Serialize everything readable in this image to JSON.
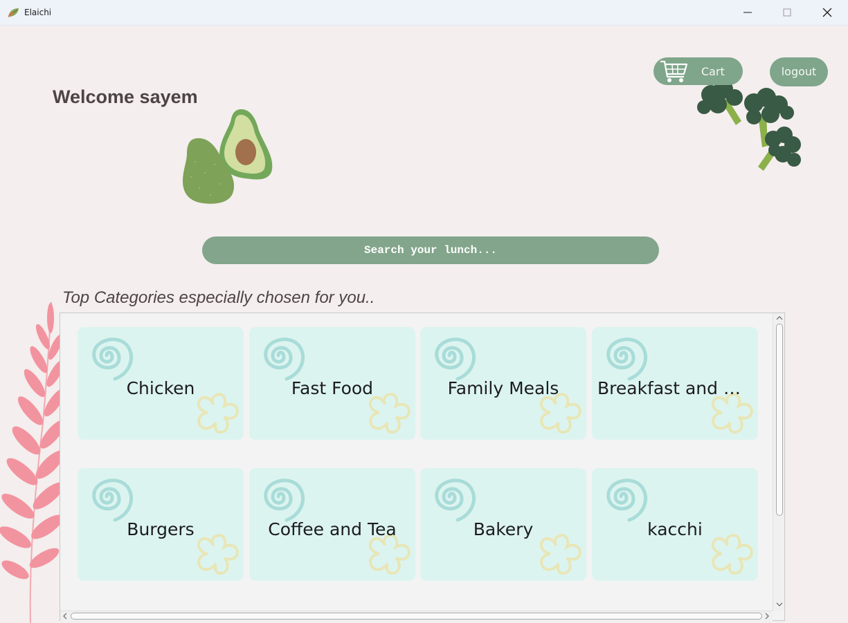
{
  "window": {
    "title": "Elaichi",
    "app_icon": "leaf-icon",
    "controls": [
      "minimize-icon",
      "maximize-icon",
      "close-icon"
    ]
  },
  "header": {
    "welcome": "Welcome sayem",
    "cart_label": "Cart",
    "cart_icon": "shopping-cart-icon",
    "logout_label": "logout"
  },
  "search": {
    "placeholder": "Search your lunch..."
  },
  "categories": {
    "title": "Top Categories especially chosen for you..",
    "items": [
      {
        "label": "Chicken"
      },
      {
        "label": "Fast Food"
      },
      {
        "label": "Family Meals"
      },
      {
        "label": "Breakfast and Br..."
      },
      {
        "label": "Burgers"
      },
      {
        "label": "Coffee and Tea"
      },
      {
        "label": "Bakery"
      },
      {
        "label": "kacchi"
      }
    ]
  },
  "colors": {
    "background": "#f4eeee",
    "accent_green": "#7fa58a",
    "card_bg": "#dcf4f0",
    "text_dark": "#4e4444"
  }
}
